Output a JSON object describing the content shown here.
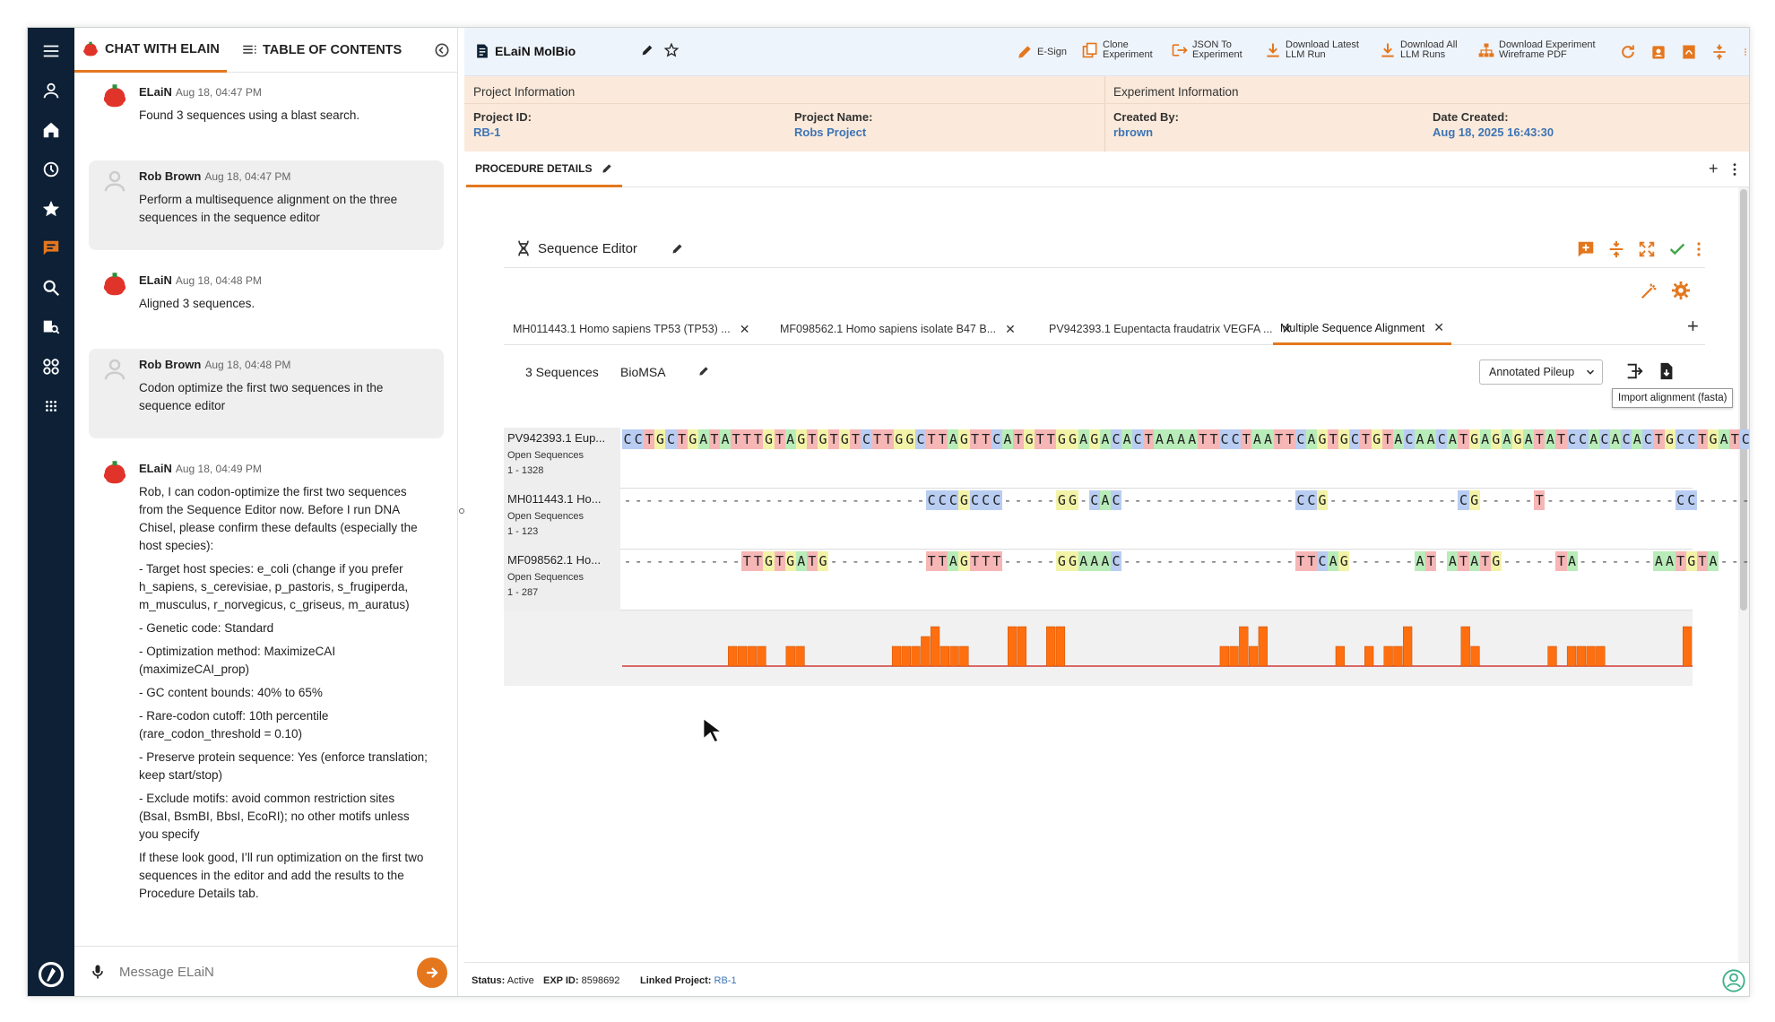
{
  "chat": {
    "tab_chat": "CHAT WITH ELAIN",
    "tab_toc": "TABLE OF CONTENTS",
    "messages": [
      {
        "author": "ELaiN",
        "time": "Aug 18, 04:47 PM",
        "body": [
          "Found 3 sequences using a blast search."
        ]
      },
      {
        "author": "Rob Brown",
        "time": "Aug 18, 04:47 PM",
        "body": [
          "Perform a multisequence alignment on the three sequences in the sequence editor"
        ]
      },
      {
        "author": "ELaiN",
        "time": "Aug 18, 04:48 PM",
        "body": [
          "Aligned 3 sequences."
        ]
      },
      {
        "author": "Rob Brown",
        "time": "Aug 18, 04:48 PM",
        "body": [
          "Codon optimize the first two sequences in the sequence editor"
        ]
      },
      {
        "author": "ELaiN",
        "time": "Aug 18, 04:49 PM",
        "body": [
          "Rob, I can codon-optimize the first two sequences from the Sequence Editor now. Before I run DNA Chisel, please confirm these defaults (especially the host species):",
          "- Target host species: e_coli (change if you prefer h_sapiens, s_cerevisiae, p_pastoris, s_frugiperda, m_musculus, r_norvegicus, c_griseus, m_auratus)",
          "- Genetic code: Standard",
          "- Optimization method: MaximizeCAI (maximizeCAI_prop)",
          "- GC content bounds: 40% to 65%",
          "- Rare-codon cutoff: 10th percentile (rare_codon_threshold = 0.10)",
          "- Preserve protein sequence: Yes (enforce translation; keep start/stop)",
          "- Exclude motifs: avoid common restriction sites (BsaI, BsmBI, BbsI, EcoRI); no other motifs unless you specify",
          "If these look good, I’ll run optimization on the first two sequences in the editor and add the results to the Procedure Details tab."
        ]
      }
    ],
    "input_placeholder": "Message ELaiN"
  },
  "topbar": {
    "app_title": "ELaiN MolBio",
    "esign": "E-Sign",
    "clone": [
      "Clone",
      "Experiment"
    ],
    "json": [
      "JSON To",
      "Experiment"
    ],
    "dl_latest": [
      "Download Latest",
      "LLM Run"
    ],
    "dl_all": [
      "Download All",
      "LLM Runs"
    ],
    "dl_pdf": [
      "Download Experiment",
      "Wireframe PDF"
    ]
  },
  "info": {
    "project_header": "Project Information",
    "experiment_header": "Experiment Information",
    "project_id_label": "Project ID:",
    "project_id": "RB-1",
    "project_name_label": "Project Name:",
    "project_name": "Robs Project",
    "created_by_label": "Created By:",
    "created_by": "rbrown",
    "date_created_label": "Date Created:",
    "date_created": "Aug 18, 2025 16:43:30"
  },
  "procedure_tab": "PROCEDURE DETAILS",
  "editor": {
    "title": "Sequence Editor",
    "tabs": [
      "MH011443.1 Homo sapiens TP53 (TP53) ...",
      "MF098562.1 Homo sapiens isolate B47 B...",
      "PV942393.1 Eupentacta fraudatrix VEGFA ...",
      "Multiple Sequence Alignment"
    ],
    "seq_count": "3 Sequences",
    "tool": "BioMSA",
    "view_select": "Annotated Pileup",
    "tooltip": "Import alignment (fasta)",
    "rows": [
      {
        "name": "PV942393.1 Eup...",
        "sub": "Open Sequences",
        "range": "1 - 1328",
        "seq": "CCTGCTGATATTTGTAGTGTGTCTTGGCTTAGTTCATGTTGGAGACACTAAAATTCCTAATTCAGTGCTGTACAACATGAGAGATATCCACACACTGCCTGATCTACTG"
      },
      {
        "name": "MH011443.1 Ho...",
        "sub": "Open Sequences",
        "range": "1 - 123",
        "seq": "----------------------------CCCGCCC-----GG-CAC----------------CCG------------CG-----T------------CC---------G"
      },
      {
        "name": "MF098562.1 Ho...",
        "sub": "Open Sequences",
        "range": "1 - 287",
        "seq": "-----------TTGTGATG---------TTAGTTT-----GGAAAC----------------TTCAG------AT-ATATG-----TA-------AATGTA---------G"
      }
    ],
    "coverage": [
      0,
      0,
      0,
      0,
      0,
      0,
      0,
      0,
      0,
      0,
      0,
      2,
      2,
      2,
      2,
      0,
      0,
      2,
      2,
      0,
      0,
      0,
      0,
      0,
      0,
      0,
      0,
      0,
      2,
      2,
      2,
      3,
      4,
      2,
      2,
      2,
      0,
      0,
      0,
      0,
      4,
      4,
      0,
      0,
      4,
      4,
      0,
      0,
      0,
      0,
      0,
      0,
      0,
      0,
      0,
      0,
      0,
      0,
      0,
      0,
      0,
      0,
      2,
      2,
      4,
      2,
      4,
      0,
      0,
      0,
      0,
      0,
      0,
      0,
      2,
      0,
      0,
      2,
      0,
      2,
      2,
      4,
      0,
      0,
      0,
      0,
      0,
      4,
      2,
      0,
      0,
      0,
      0,
      0,
      0,
      0,
      2,
      0,
      2,
      2,
      2,
      2,
      0,
      0,
      0,
      0,
      0,
      0,
      0,
      0,
      4
    ]
  },
  "footer": {
    "status_label": "Status:",
    "status": "Active",
    "exp_label": "EXP ID:",
    "exp_id": "8598692",
    "linked_label": "Linked Project:",
    "linked": "RB-1"
  },
  "colors": {
    "accent": "#e4771e",
    "rail": "#0d2036",
    "link": "#3d74b5"
  }
}
